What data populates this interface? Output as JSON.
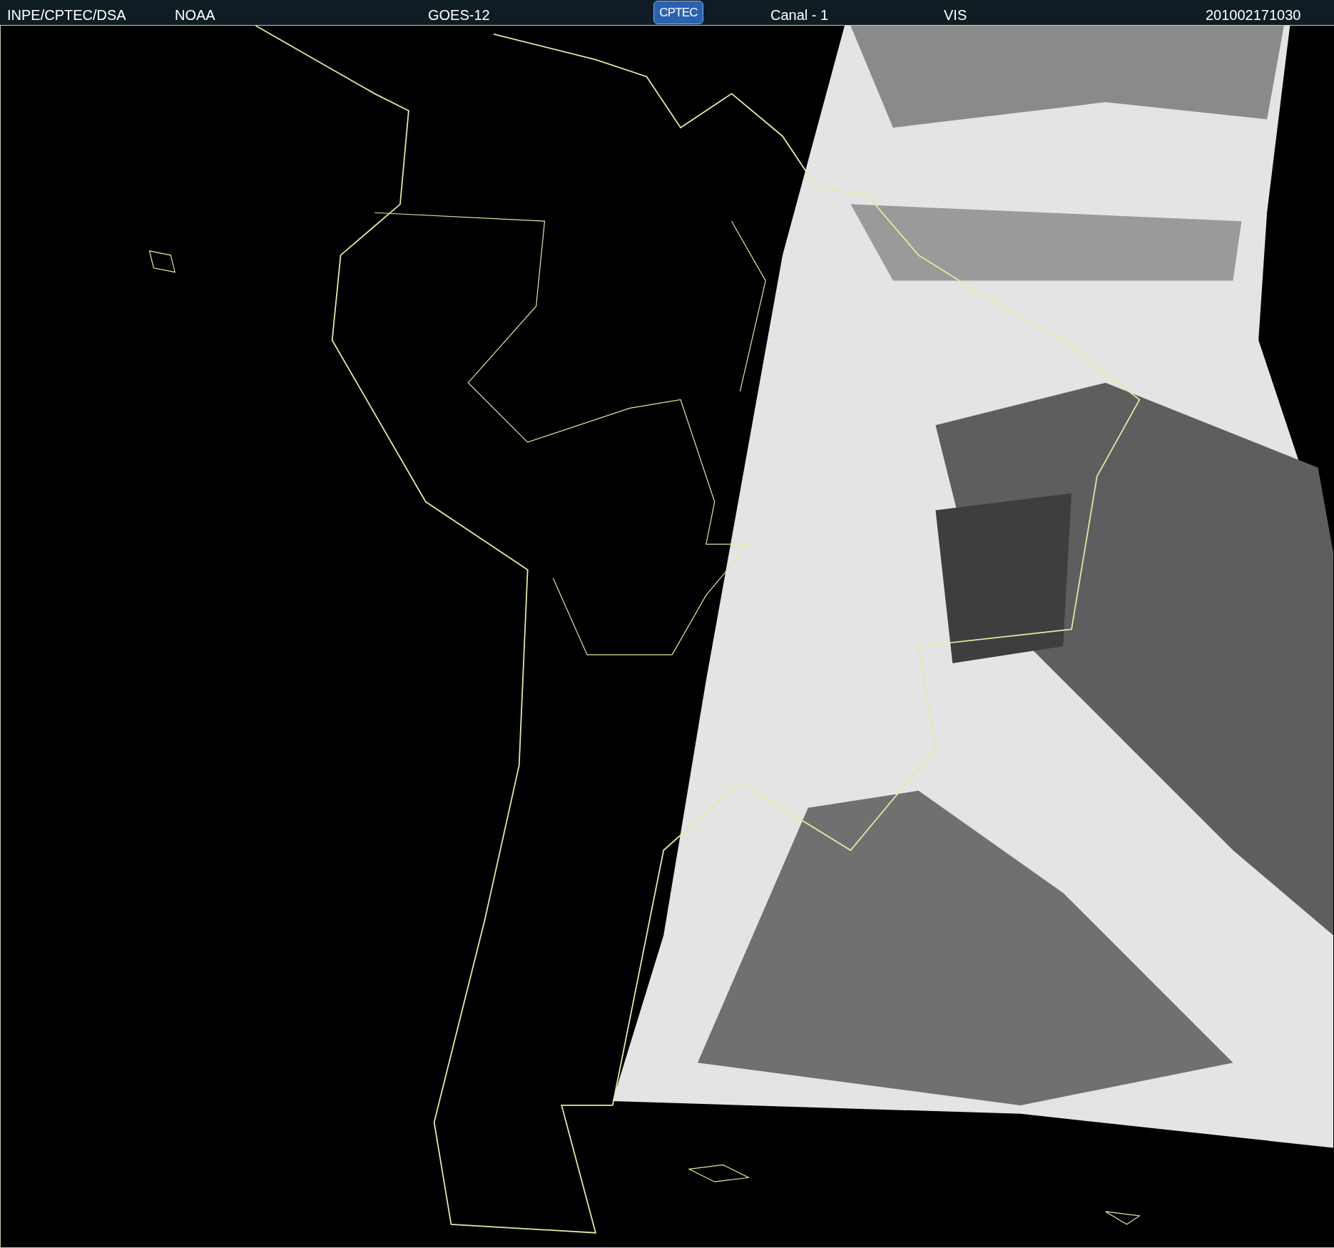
{
  "header": {
    "source": "INPE/CPTEC/DSA",
    "agency": "NOAA",
    "satellite": "GOES-12",
    "logo": "CPTEC",
    "channel": "Canal - 1",
    "band": "VIS",
    "timestamp": "201002171030"
  }
}
